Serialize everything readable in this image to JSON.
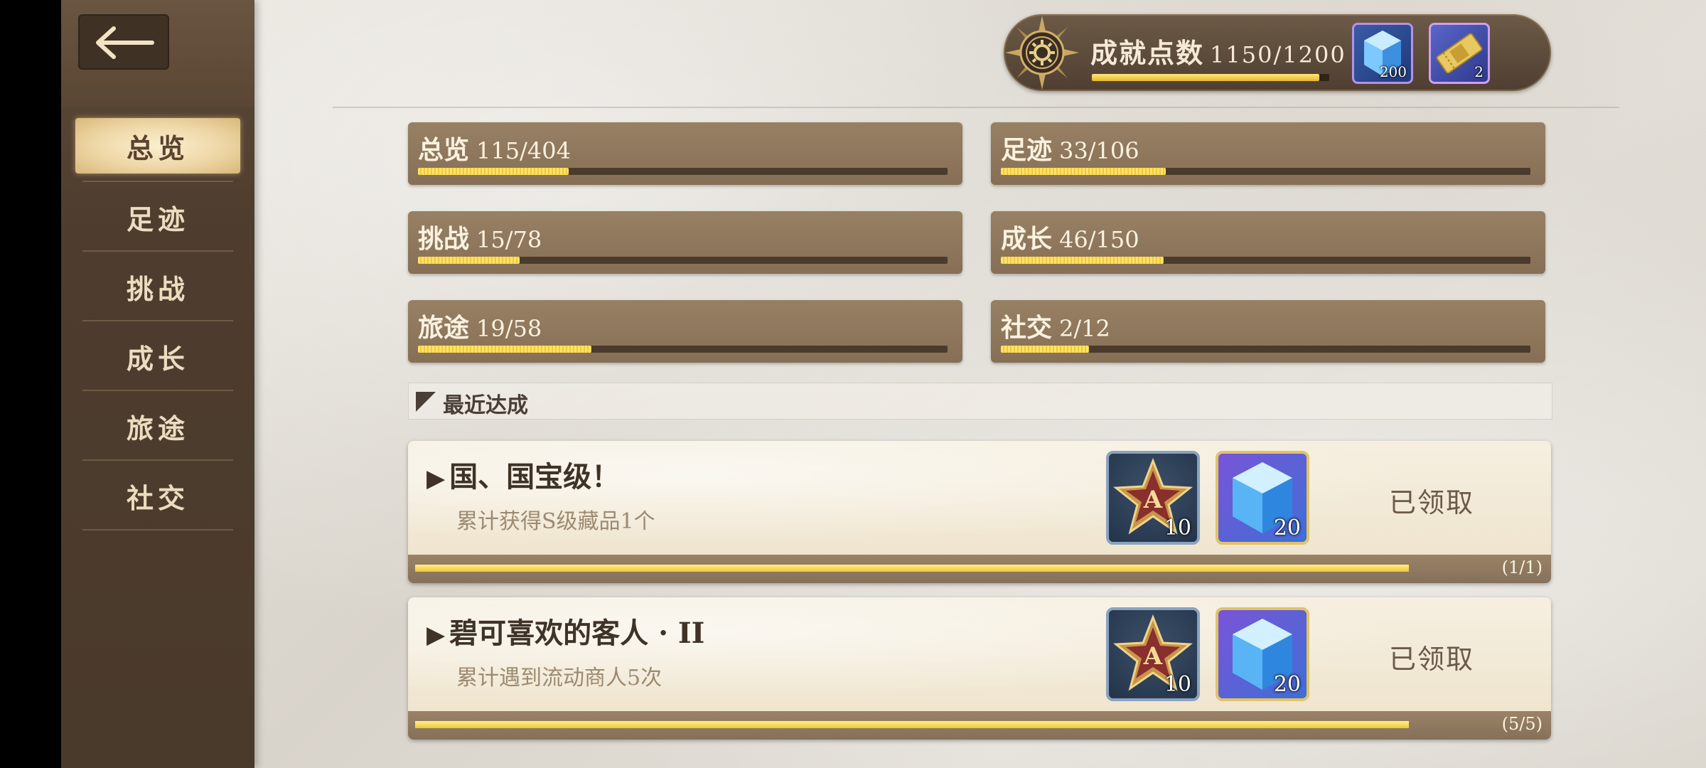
{
  "header": {
    "points_label": "成就点数",
    "points_value": "1150/1200",
    "points_progress": 0.958,
    "rewards": [
      {
        "icon": "crystal-cube-icon",
        "count": "200"
      },
      {
        "icon": "gold-ticket-icon",
        "count": "2"
      }
    ]
  },
  "sidebar": {
    "items": [
      {
        "label": "总览",
        "active": true
      },
      {
        "label": "足迹"
      },
      {
        "label": "挑战"
      },
      {
        "label": "成长"
      },
      {
        "label": "旅途"
      },
      {
        "label": "社交"
      }
    ]
  },
  "categories": [
    {
      "name": "总览",
      "value": "115/404",
      "progress": 0.285
    },
    {
      "name": "足迹",
      "value": "33/106",
      "progress": 0.311
    },
    {
      "name": "挑战",
      "value": "15/78",
      "progress": 0.192
    },
    {
      "name": "成长",
      "value": "46/150",
      "progress": 0.307
    },
    {
      "name": "旅途",
      "value": "19/58",
      "progress": 0.328
    },
    {
      "name": "社交",
      "value": "2/12",
      "progress": 0.167
    }
  ],
  "recent": {
    "title": "最近达成",
    "items": [
      {
        "title": "国、国宝级！",
        "description": "累计获得S级藏品1个",
        "rewards": [
          {
            "icon": "a-rank-star-icon",
            "count": "10"
          },
          {
            "icon": "crystal-cube-icon",
            "count": "20"
          }
        ],
        "status": "已领取",
        "progress_text": "(1/1)",
        "progress": 1.0
      },
      {
        "title": "碧可喜欢的客人 · II",
        "description": "累计遇到流动商人5次",
        "rewards": [
          {
            "icon": "a-rank-star-icon",
            "count": "10"
          },
          {
            "icon": "crystal-cube-icon",
            "count": "20"
          }
        ],
        "status": "已领取",
        "progress_text": "(5/5)",
        "progress": 1.0
      }
    ]
  }
}
